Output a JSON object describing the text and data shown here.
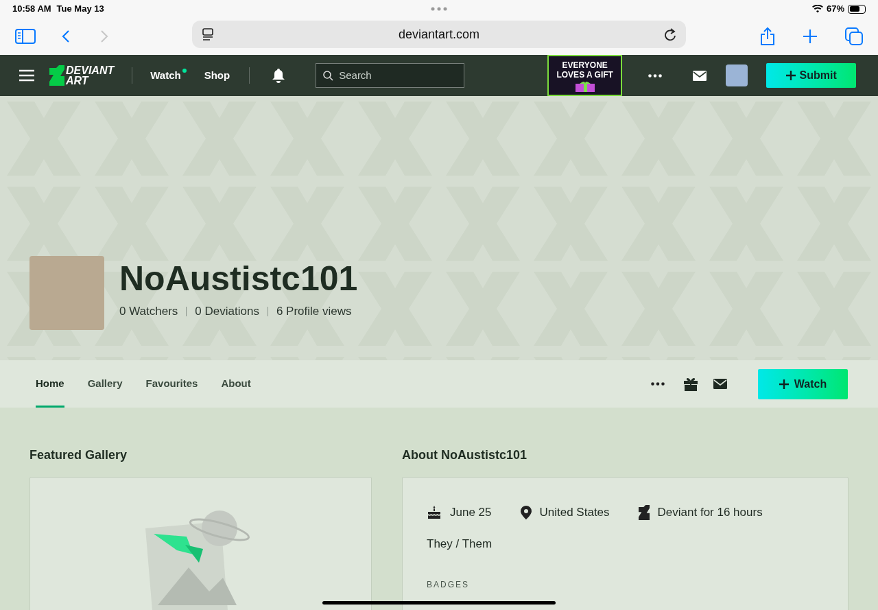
{
  "status_bar": {
    "time": "10:58 AM",
    "date": "Tue May 13",
    "battery": "67%"
  },
  "browser": {
    "url": "deviantart.com"
  },
  "site_nav": {
    "logo_lines": [
      "DEVIANT",
      "ART"
    ],
    "links": [
      {
        "label": "Watch",
        "notification_dot": true
      },
      {
        "label": "Shop",
        "notification_dot": false
      }
    ],
    "search": {
      "placeholder": "Search"
    },
    "promo_lines": [
      "EVERYONE",
      "LOVES A GIFT"
    ],
    "submit": "Submit"
  },
  "profile": {
    "username": "NoAustistc101",
    "stats": [
      "0 Watchers",
      "0 Deviations",
      "6 Profile views"
    ]
  },
  "tabs": [
    {
      "label": "Home",
      "selected": true
    },
    {
      "label": "Gallery",
      "selected": false
    },
    {
      "label": "Favourites",
      "selected": false
    },
    {
      "label": "About",
      "selected": false
    }
  ],
  "watch_button": "Watch",
  "featured": {
    "title": "Featured Gallery"
  },
  "about": {
    "title": "About NoAustistc101",
    "facts": [
      {
        "kind": "birthday",
        "text": "June 25"
      },
      {
        "kind": "location",
        "text": "United States"
      },
      {
        "kind": "member",
        "text": "Deviant for 16 hours"
      }
    ],
    "pronouns": "They / Them",
    "badges_label": "BADGES"
  }
}
